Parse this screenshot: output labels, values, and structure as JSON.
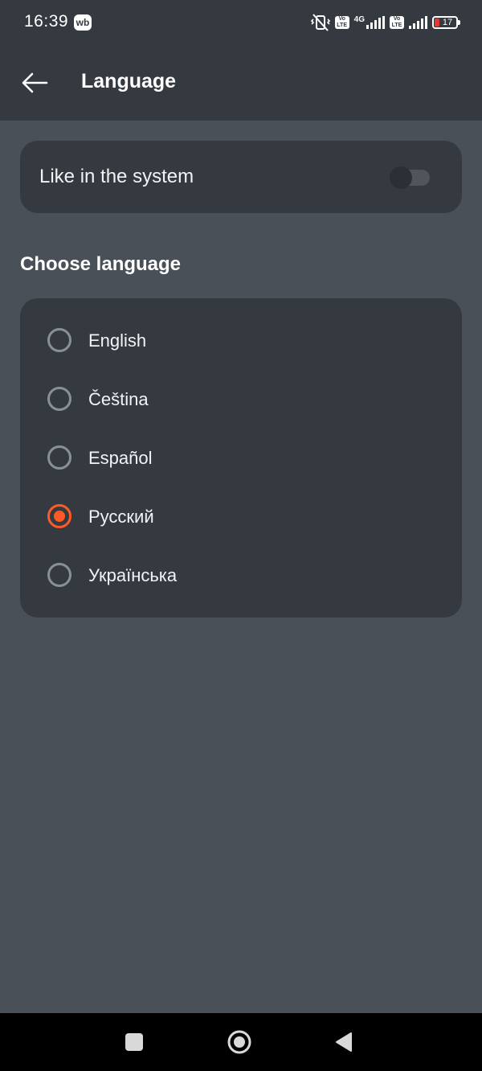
{
  "status_bar": {
    "time": "16:39",
    "app_badge": "wb",
    "network": "4G",
    "volte_1": "Vo LTE",
    "volte_2": "Vo LTE",
    "battery": "17"
  },
  "toolbar": {
    "title": "Language"
  },
  "system_setting": {
    "label": "Like in the system",
    "enabled": false
  },
  "choose_language": {
    "title": "Choose language",
    "options": [
      {
        "label": "English",
        "selected": false
      },
      {
        "label": "Čeština",
        "selected": false
      },
      {
        "label": "Español",
        "selected": false
      },
      {
        "label": "Русский",
        "selected": true
      },
      {
        "label": "Українська",
        "selected": false
      }
    ]
  },
  "colors": {
    "accent": "#ff5a26",
    "background": "#4a5058",
    "surface": "#353a41"
  },
  "icons": {
    "back": "arrow-left-icon",
    "nav_recents": "square-icon",
    "nav_home": "circle-icon",
    "nav_back": "triangle-icon"
  }
}
